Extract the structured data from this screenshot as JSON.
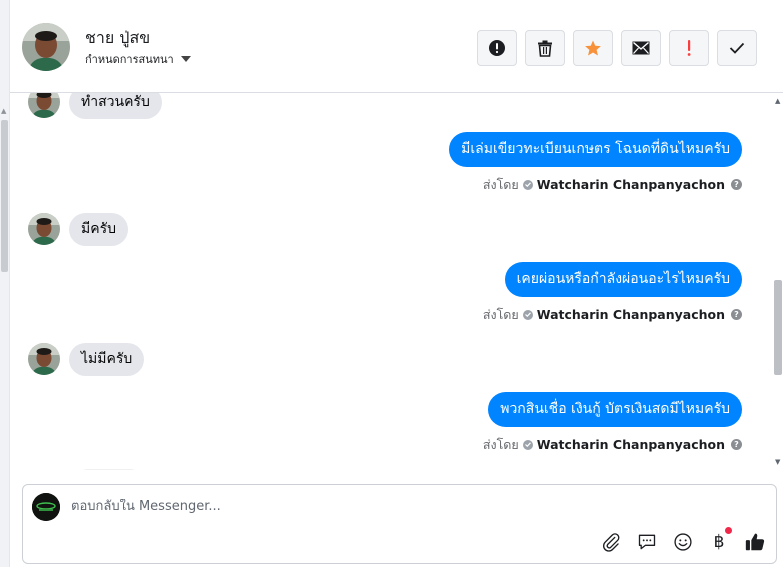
{
  "header": {
    "contact_name": "ชาย ปู่สข",
    "assign_label": "กำหนดการสนทนา",
    "actions": [
      {
        "name": "mark-spam",
        "icon": "exclamation-circle-icon"
      },
      {
        "name": "delete",
        "icon": "trash-icon"
      },
      {
        "name": "star",
        "icon": "star-icon",
        "color": "#f7923b"
      },
      {
        "name": "mark-unread",
        "icon": "envelope-icon"
      },
      {
        "name": "follow-up",
        "icon": "exclamation-icon",
        "color": "#fa3e3e"
      },
      {
        "name": "mark-done",
        "icon": "checkmark-icon"
      }
    ]
  },
  "messages": [
    {
      "direction": "in",
      "text": "ทำสวนครับ"
    },
    {
      "direction": "out",
      "text": "มีเล่มเขียวทะเบียนเกษตร โฉนดที่ดินไหมครับ",
      "sent_label": "ส่งโดย",
      "agent": "Watcharin Chanpanyachon",
      "help": "?"
    },
    {
      "direction": "in",
      "text": "มีครับ"
    },
    {
      "direction": "out",
      "text": "เคยผ่อนหรือกำลังผ่อนอะไรไหมครับ",
      "sent_label": "ส่งโดย",
      "agent": "Watcharin Chanpanyachon",
      "help": "?"
    },
    {
      "direction": "in",
      "text": "ไม่มีครับ"
    },
    {
      "direction": "out",
      "text": "พวกสินเชื่อ เงินกู้ บัตรเงินสดมีไหมครับ",
      "sent_label": "ส่งโดย",
      "agent": "Watcharin Chanpanyachon",
      "help": "?"
    }
  ],
  "composer": {
    "placeholder": "ตอบกลับใน Messenger...",
    "value": "",
    "tools": [
      "paperclip-icon",
      "saved-reply-icon",
      "emoji-icon",
      "baht-icon",
      "thumbs-up-icon"
    ],
    "baht_symbol": "฿"
  },
  "colors": {
    "outgoing_bubble": "#0084ff",
    "incoming_bubble": "#e4e6eb",
    "star": "#f7923b",
    "alert": "#fa3e3e"
  }
}
